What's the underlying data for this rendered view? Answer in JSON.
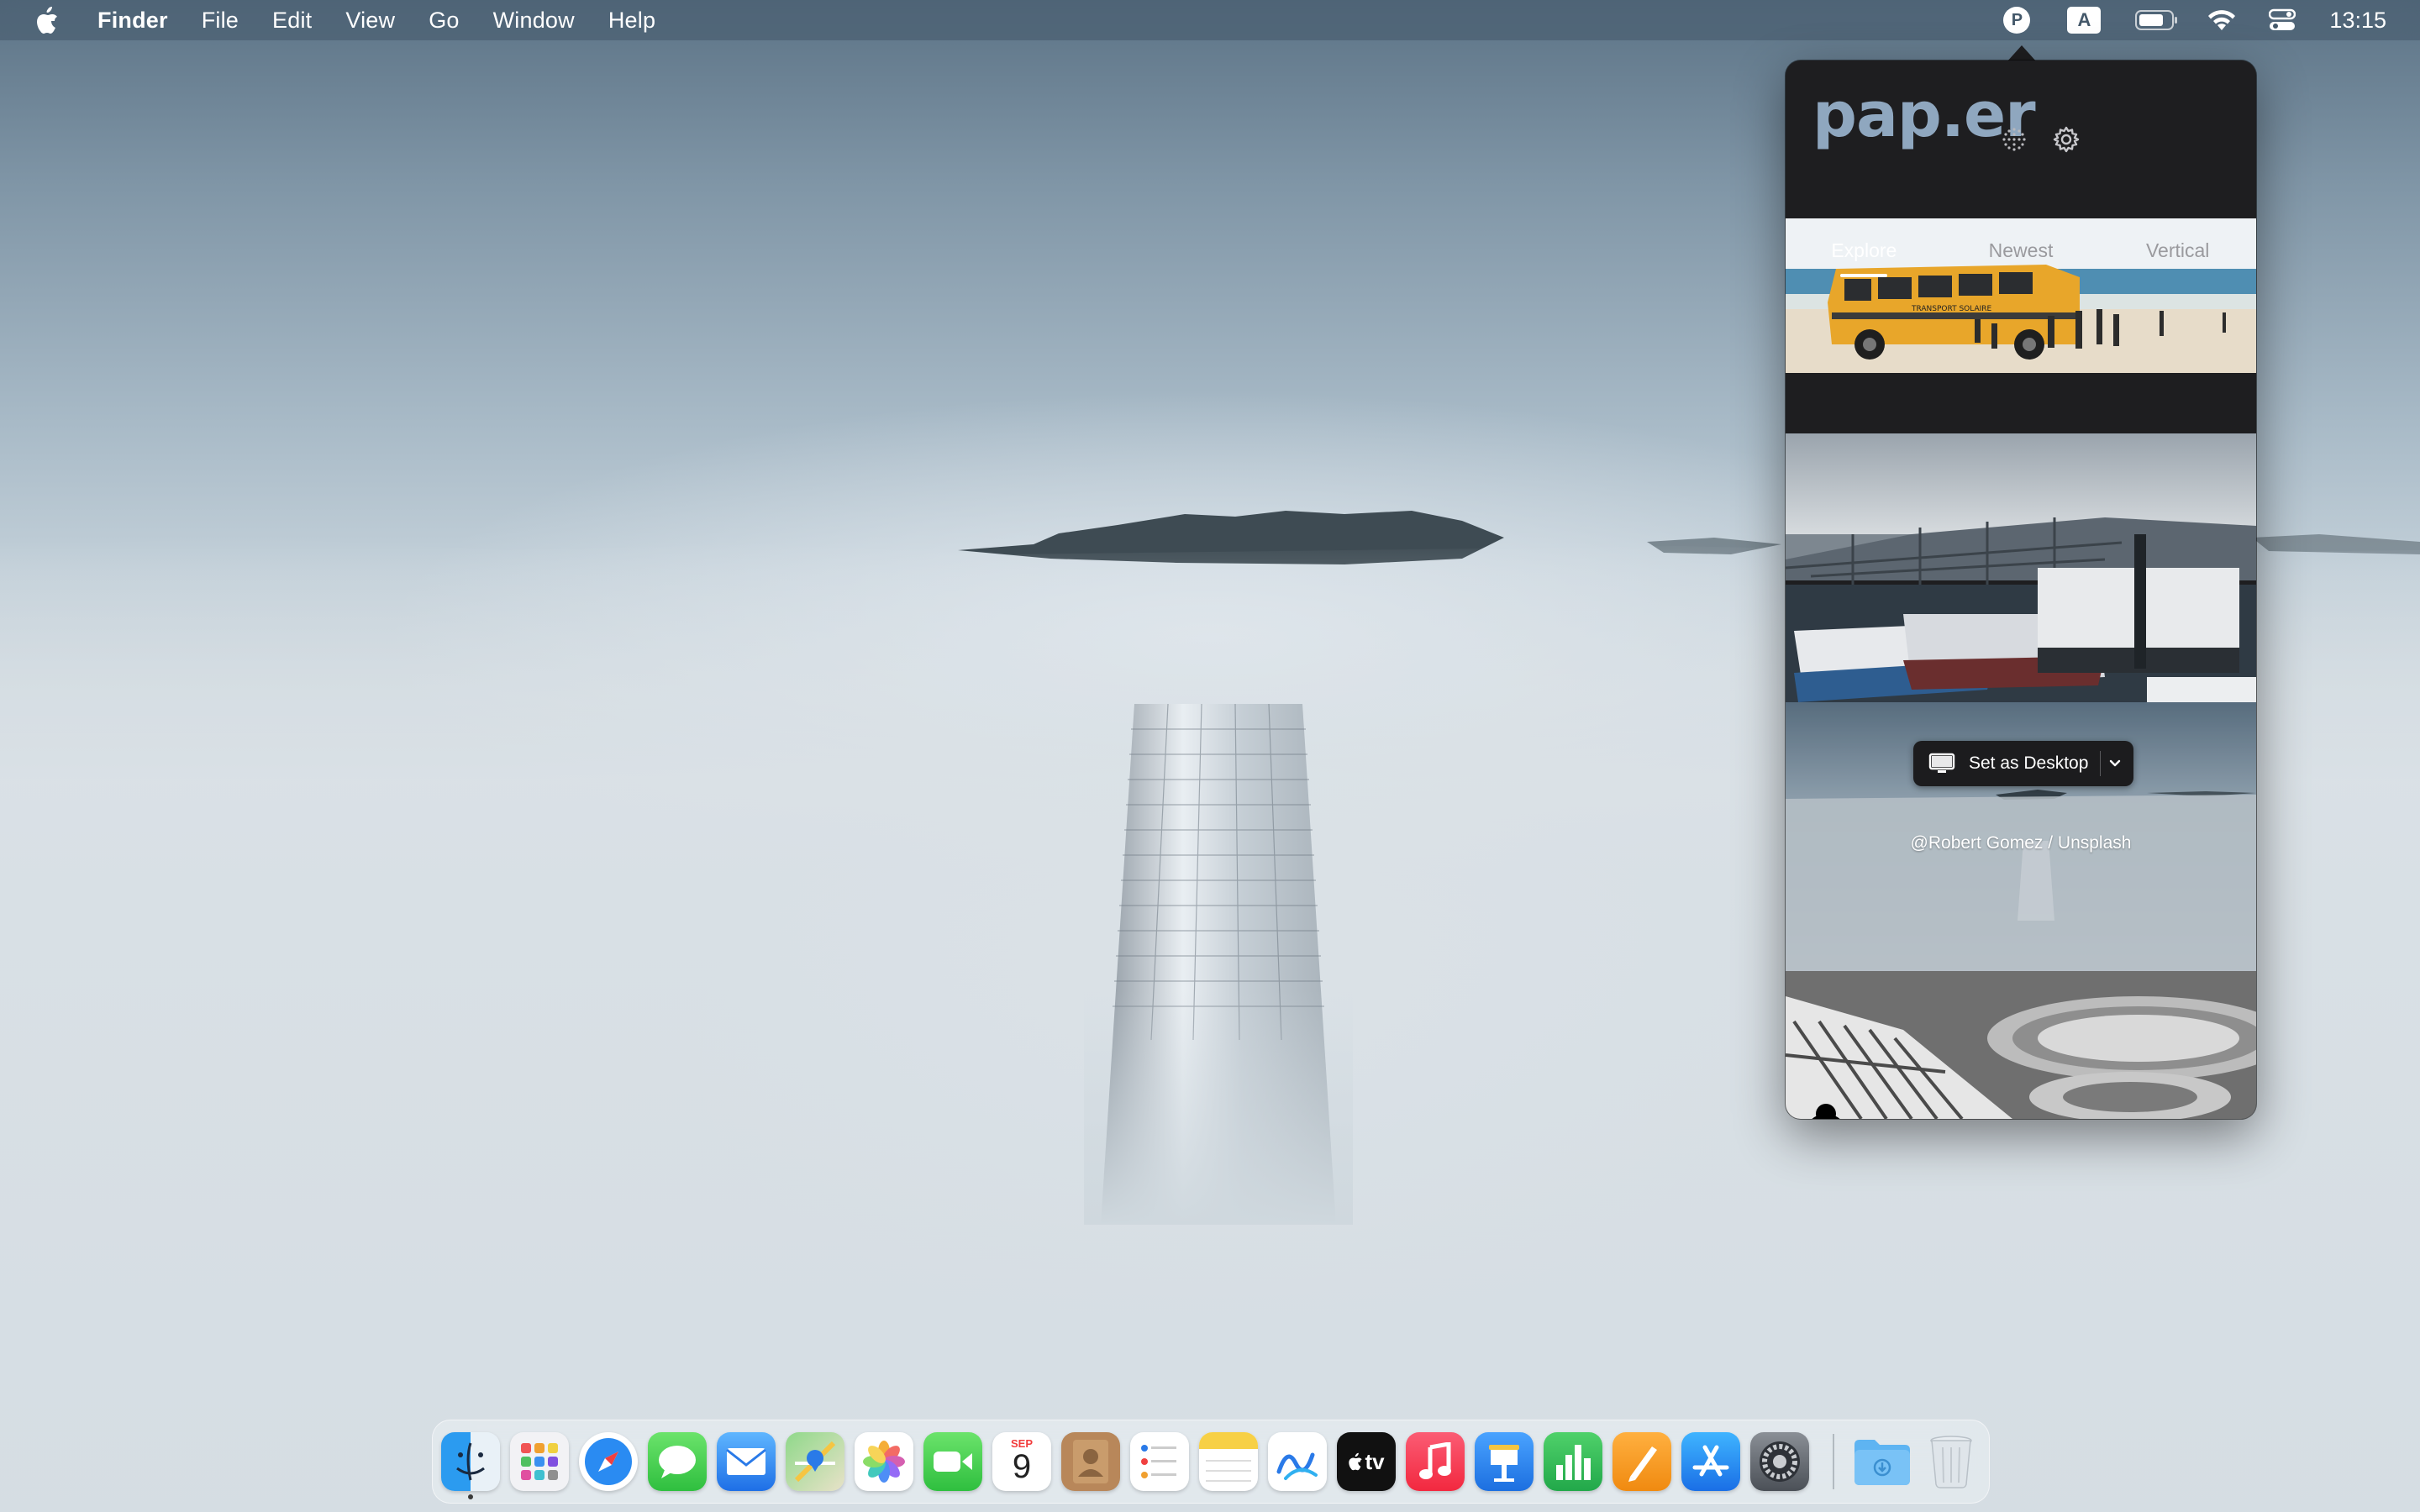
{
  "menubar": {
    "apple_icon": "apple-logo-icon",
    "app_name": "Finder",
    "menus": [
      "File",
      "Edit",
      "View",
      "Go",
      "Window",
      "Help"
    ],
    "status_icons": [
      "paper-app-icon",
      "input-source-icon",
      "battery-icon",
      "wifi-icon",
      "control-center-icon"
    ],
    "paper_letter": "P",
    "input_source_letter": "A",
    "clock": "13:15"
  },
  "popover": {
    "logo": "pap.er",
    "header_icons": [
      "shuffle-dots-icon",
      "gear-icon"
    ],
    "tabs": [
      "Explore",
      "Newest",
      "Vertical"
    ],
    "active_tab": "Explore",
    "set_desktop_label": "Set as Desktop",
    "credit": "@Robert Gomez / Unsplash",
    "van_text": "TRANSPORT SOLAIRE"
  },
  "dock": {
    "apps": [
      "Finder",
      "Launchpad",
      "Safari",
      "Messages",
      "Mail",
      "Maps",
      "Photos",
      "FaceTime",
      "Calendar",
      "Contacts",
      "Reminders",
      "Notes",
      "Freeform",
      "TV",
      "Music",
      "Keynote",
      "Numbers",
      "Pages",
      "App Store",
      "System Settings",
      "Downloads",
      "Trash"
    ],
    "calendar_month": "SEP",
    "calendar_day": "9",
    "tv_label": "tv"
  },
  "colors": {
    "menubar": "#44586a",
    "popover_bg": "#1e1e20",
    "logo": "#8fa7bf",
    "accent_blue": "#1e7cf2"
  }
}
